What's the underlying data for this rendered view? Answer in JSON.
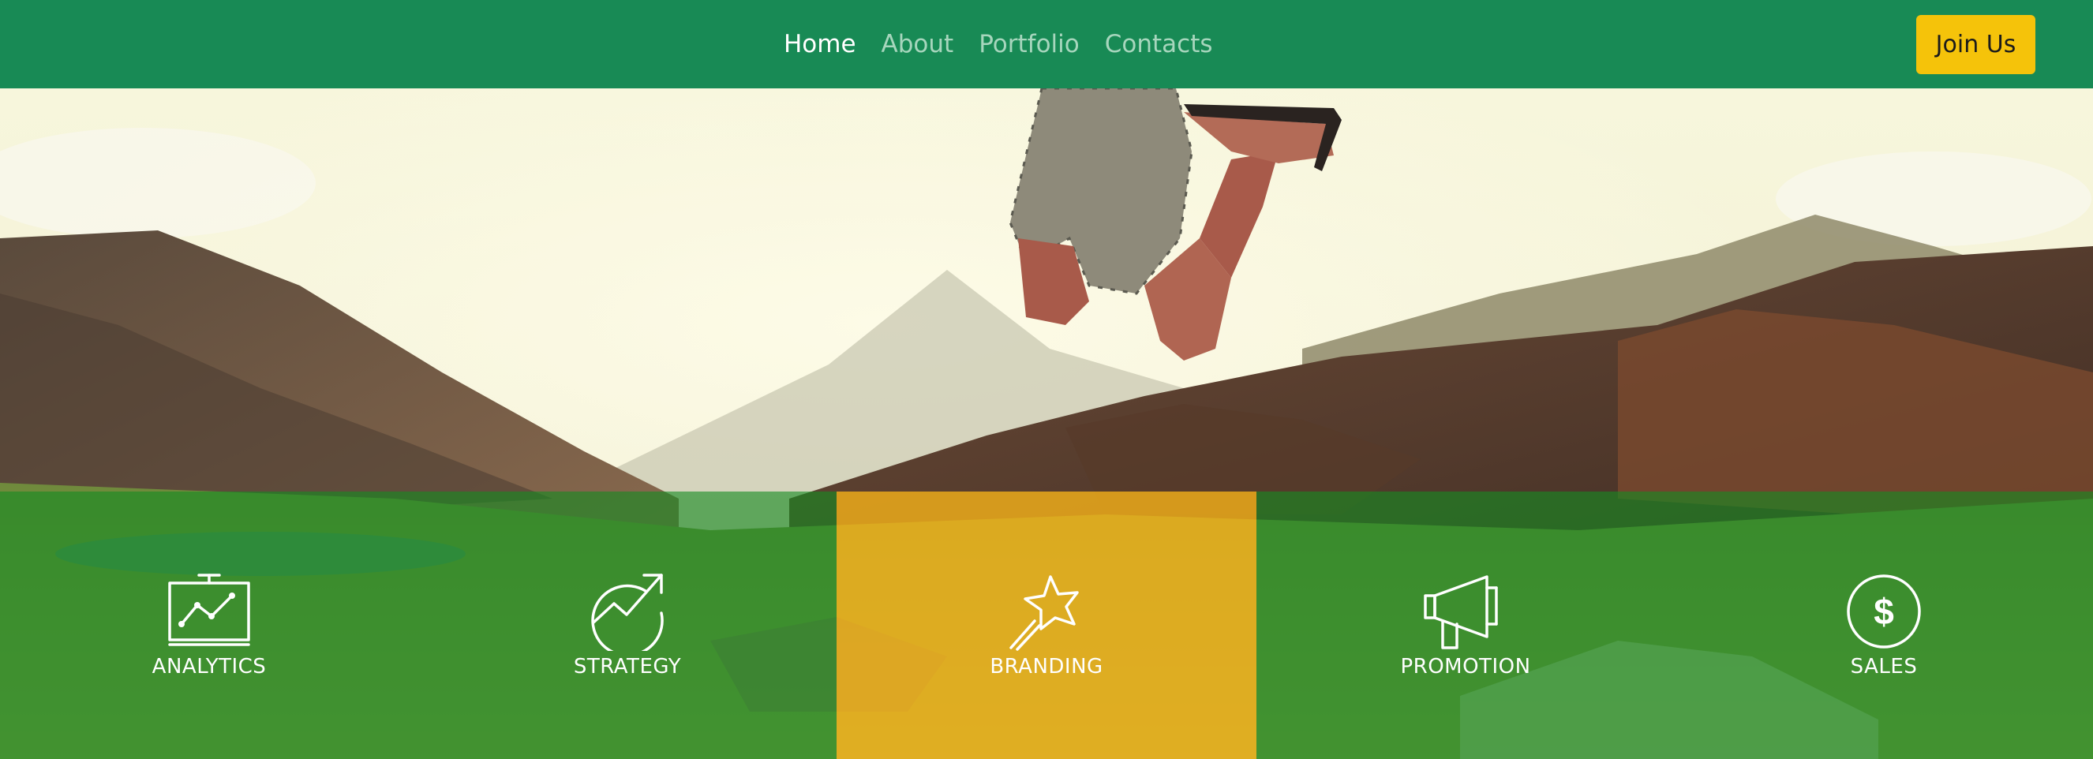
{
  "nav": {
    "links": [
      {
        "label": "Home",
        "active": true
      },
      {
        "label": "About",
        "active": false
      },
      {
        "label": "Portfolio",
        "active": false
      },
      {
        "label": "Contacts",
        "active": false
      }
    ],
    "cta_label": "Join Us"
  },
  "features": [
    {
      "label": "ANALYTICS",
      "icon": "presentation-chart-icon",
      "highlighted": false
    },
    {
      "label": "STRATEGY",
      "icon": "growth-arrow-icon",
      "highlighted": false
    },
    {
      "label": "BRANDING",
      "icon": "magic-wand-star-icon",
      "highlighted": true
    },
    {
      "label": "PROMOTION",
      "icon": "megaphone-icon",
      "highlighted": false
    },
    {
      "label": "SALES",
      "icon": "dollar-coin-icon",
      "highlighted": false
    }
  ],
  "colors": {
    "nav_background": "#188a55",
    "cta_background": "#f5c30a",
    "feature_overlay": "#168a22",
    "feature_highlight": "#f5b219"
  }
}
